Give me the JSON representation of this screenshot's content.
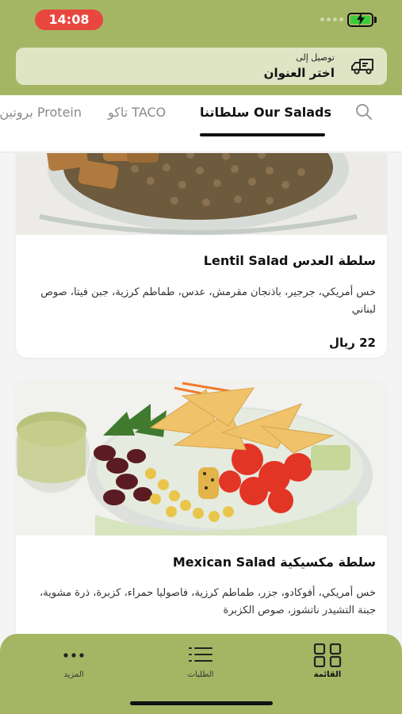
{
  "status_bar": {
    "time": "14:08"
  },
  "address_bar": {
    "label": "توصيل إلى",
    "value": "اختر العنوان",
    "icon": "delivery-truck-icon"
  },
  "tabs": [
    {
      "label": "سلطاتنا Our Salads",
      "active": true
    },
    {
      "label": "تاكو TACO",
      "active": false
    },
    {
      "label": "بروتين Protein",
      "active": false
    }
  ],
  "products": [
    {
      "title": "سلطة العدس Lentil Salad",
      "description": "خس أمريكي، جرجير، باذنجان مقرمش، عدس، طماطم كرزية، جبن فيتا، صوص لبناني",
      "price": "22 ريال"
    },
    {
      "title": "سلطة مكسيكية Mexican Salad",
      "description": "خس أمريكي، أفوكادو، جزر، طماطم كرزية، فاصوليا حمراء، كزبرة، ذرة مشوية، جبنة التشيدر ناتشوز، صوص الكزبرة",
      "price": ""
    }
  ],
  "bottom_nav": [
    {
      "label": "القائمة",
      "icon": "grid-menu-icon",
      "active": true
    },
    {
      "label": "الطلبات",
      "icon": "list-icon",
      "active": false
    },
    {
      "label": "المزيد",
      "icon": "more-dots-icon",
      "active": false
    }
  ],
  "colors": {
    "brand_green": "#a4b664",
    "address_bg": "#dfe5c4",
    "time_pill": "#e8473f",
    "battery_fill": "#3ccb3c"
  }
}
